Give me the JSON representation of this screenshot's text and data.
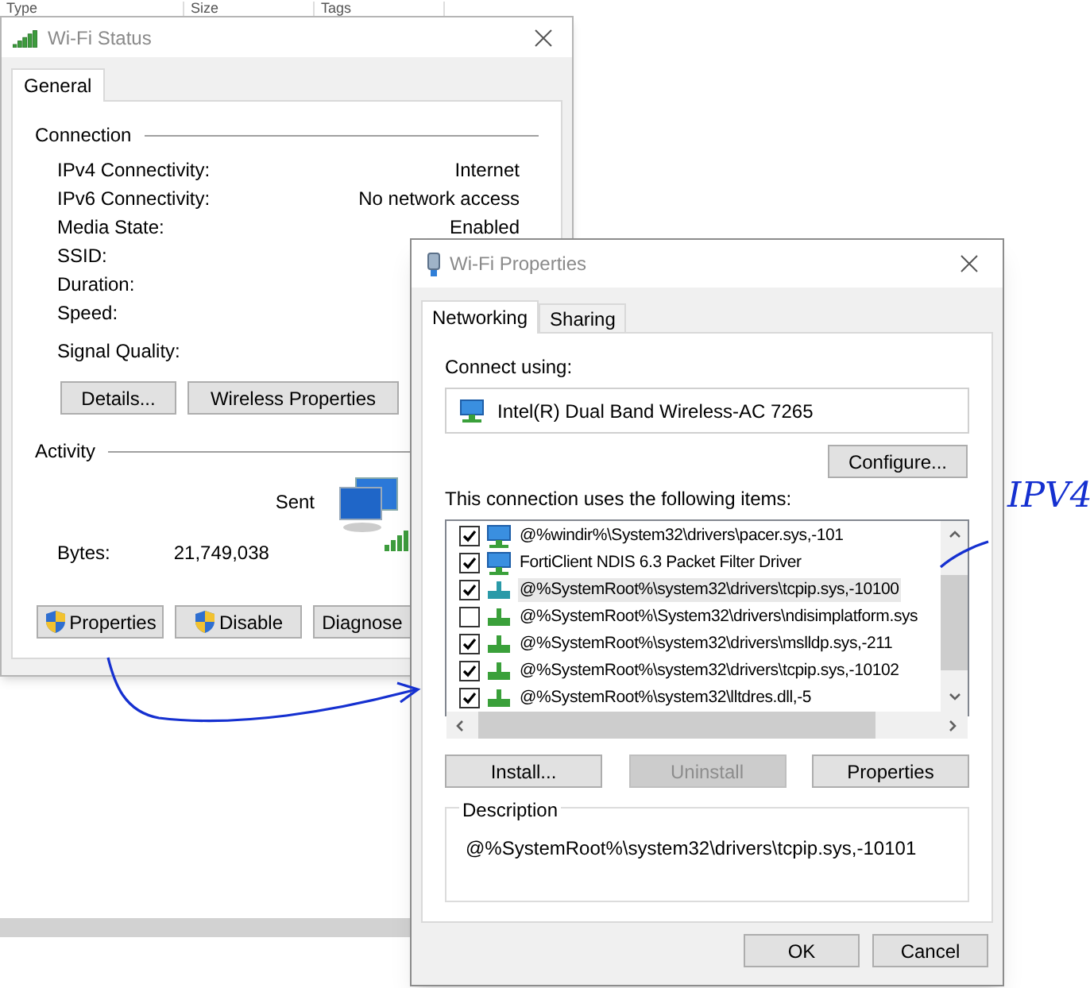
{
  "background_list": {
    "columns": [
      "Type",
      "Size",
      "Tags"
    ]
  },
  "status_window": {
    "title": "Wi-Fi Status",
    "tabs": [
      {
        "label": "General",
        "selected": true
      }
    ],
    "connection": {
      "heading": "Connection",
      "rows": [
        {
          "label": "IPv4 Connectivity:",
          "value": "Internet"
        },
        {
          "label": "IPv6 Connectivity:",
          "value": "No network access"
        },
        {
          "label": "Media State:",
          "value": "Enabled"
        },
        {
          "label": "SSID:"
        },
        {
          "label": "Duration:"
        },
        {
          "label": "Speed:"
        }
      ],
      "signal_quality_label": "Signal Quality:"
    },
    "buttons": [
      "Details...",
      "Wireless Properties"
    ],
    "activity": {
      "heading": "Activity",
      "sent_label": "Sent",
      "bytes_label": "Bytes:",
      "bytes_sent": "21,749,038"
    },
    "action_buttons": [
      {
        "label": "Properties",
        "shield": true
      },
      {
        "label": "Disable",
        "shield": true
      },
      {
        "label": "Diagnose",
        "shield": false
      }
    ]
  },
  "properties_window": {
    "title": "Wi-Fi Properties",
    "tabs": [
      {
        "label": "Networking",
        "selected": true
      },
      {
        "label": "Sharing",
        "selected": false
      }
    ],
    "connect_using_label": "Connect using:",
    "adapter": "Intel(R) Dual Band Wireless-AC 7265",
    "configure_button": "Configure...",
    "items_label": "This connection uses the following items:",
    "items": [
      {
        "kind": "service",
        "label": "@%windir%\\System32\\drivers\\pacer.sys,-101",
        "checked": true,
        "selected": false
      },
      {
        "kind": "service",
        "label": "FortiClient NDIS 6.3 Packet Filter Driver",
        "checked": true,
        "selected": false
      },
      {
        "kind": "protocol",
        "label": "@%SystemRoot%\\system32\\drivers\\tcpip.sys,-10100",
        "checked": true,
        "selected": true
      },
      {
        "kind": "protocol",
        "label": "@%SystemRoot%\\System32\\drivers\\ndisimplatform.sys",
        "checked": false,
        "selected": false
      },
      {
        "kind": "protocol",
        "label": "@%SystemRoot%\\system32\\drivers\\mslldp.sys,-211",
        "checked": true,
        "selected": false
      },
      {
        "kind": "protocol",
        "label": "@%SystemRoot%\\system32\\drivers\\tcpip.sys,-10102",
        "checked": true,
        "selected": false
      },
      {
        "kind": "protocol",
        "label": "@%SystemRoot%\\system32\\lltdres.dll,-5",
        "checked": true,
        "selected": false
      }
    ],
    "item_buttons": [
      {
        "label": "Install...",
        "disabled": false
      },
      {
        "label": "Uninstall",
        "disabled": true
      },
      {
        "label": "Properties",
        "disabled": false
      }
    ],
    "description": {
      "heading": "Description",
      "text": "@%SystemRoot%\\system32\\drivers\\tcpip.sys,-10101"
    },
    "buttons": [
      "OK",
      "Cancel"
    ]
  },
  "annotation": {
    "text": "IPV4"
  }
}
